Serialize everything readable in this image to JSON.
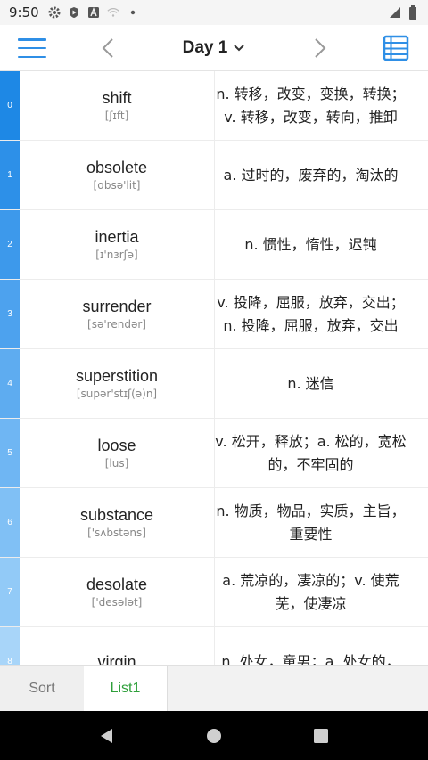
{
  "status_bar": {
    "time": "9:50"
  },
  "header": {
    "title": "Day 1"
  },
  "colors": {
    "accent": "#2f8fe6",
    "active_tab": "#2e9f3a",
    "index_strip": [
      "#1e88e5",
      "#2d90e8",
      "#3d99eb",
      "#4da2ee",
      "#5eacf0",
      "#6fb6f3",
      "#80c0f5",
      "#92caf7",
      "#a8d5f9"
    ]
  },
  "words": [
    {
      "index": "0",
      "word": "shift",
      "phonetic": "[ʃɪft]",
      "meaning": "n. 转移，改变，变换，转换；v. 转移，改变，转向，推卸"
    },
    {
      "index": "1",
      "word": "obsolete",
      "phonetic": "[ɑbsə'lit]",
      "meaning": "a. 过时的，废弃的，淘汰的"
    },
    {
      "index": "2",
      "word": "inertia",
      "phonetic": "[ɪ'nɜrʃə]",
      "meaning": "n. 惯性，惰性，迟钝"
    },
    {
      "index": "3",
      "word": "surrender",
      "phonetic": "[sə'rendər]",
      "meaning": "v. 投降，屈服，放弃，交出；n. 投降，屈服，放弃，交出"
    },
    {
      "index": "4",
      "word": "superstition",
      "phonetic": "[supər'stɪʃ(ə)n]",
      "meaning": "n. 迷信"
    },
    {
      "index": "5",
      "word": "loose",
      "phonetic": "[lus]",
      "meaning": "v. 松开，释放；a. 松的，宽松的，不牢固的"
    },
    {
      "index": "6",
      "word": "substance",
      "phonetic": "['sʌbstəns]",
      "meaning": "n. 物质，物品，实质，主旨，重要性"
    },
    {
      "index": "7",
      "word": "desolate",
      "phonetic": "['desələt]",
      "meaning": "a. 荒凉的，凄凉的；v. 使荒芜，使凄凉"
    },
    {
      "index": "8",
      "word": "virgin",
      "phonetic": "",
      "meaning": "n. 处女，童男；a. 处女的，"
    }
  ],
  "tabs": {
    "sort": "Sort",
    "list1": "List1"
  }
}
